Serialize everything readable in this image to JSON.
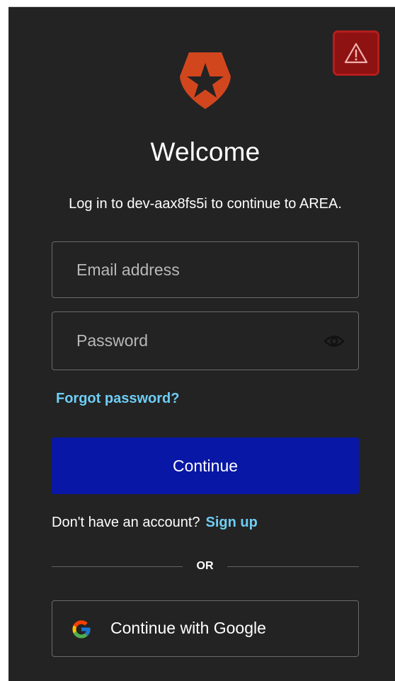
{
  "header": {
    "title": "Welcome",
    "subtitle": "Log in to dev-aax8fs5i to continue to AREA."
  },
  "form": {
    "email_placeholder": "Email address",
    "password_placeholder": "Password",
    "forgot_password": "Forgot password?",
    "continue_label": "Continue"
  },
  "signup": {
    "prompt": "Don't have an account?",
    "link": "Sign up"
  },
  "divider": {
    "label": "OR"
  },
  "social": {
    "google_label": "Continue with Google"
  },
  "icons": {
    "logo": "auth0-star-shield-icon",
    "warning": "warning-triangle-icon",
    "password_toggle": "eye-icon",
    "google": "google-g-icon"
  },
  "colors": {
    "background": "#232323",
    "primary_button": "#0817a5",
    "link": "#6fcdf5",
    "logo": "#d2461e",
    "warning": "#8f1212"
  }
}
